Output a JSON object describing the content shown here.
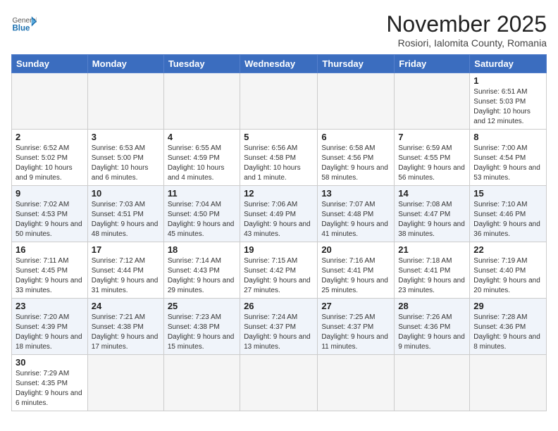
{
  "logo": {
    "general": "General",
    "blue": "Blue"
  },
  "title": "November 2025",
  "location": "Rosiori, Ialomita County, Romania",
  "headers": [
    "Sunday",
    "Monday",
    "Tuesday",
    "Wednesday",
    "Thursday",
    "Friday",
    "Saturday"
  ],
  "weeks": [
    [
      {
        "day": "",
        "info": ""
      },
      {
        "day": "",
        "info": ""
      },
      {
        "day": "",
        "info": ""
      },
      {
        "day": "",
        "info": ""
      },
      {
        "day": "",
        "info": ""
      },
      {
        "day": "",
        "info": ""
      },
      {
        "day": "1",
        "info": "Sunrise: 6:51 AM\nSunset: 5:03 PM\nDaylight: 10 hours and 12 minutes."
      }
    ],
    [
      {
        "day": "2",
        "info": "Sunrise: 6:52 AM\nSunset: 5:02 PM\nDaylight: 10 hours and 9 minutes."
      },
      {
        "day": "3",
        "info": "Sunrise: 6:53 AM\nSunset: 5:00 PM\nDaylight: 10 hours and 6 minutes."
      },
      {
        "day": "4",
        "info": "Sunrise: 6:55 AM\nSunset: 4:59 PM\nDaylight: 10 hours and 4 minutes."
      },
      {
        "day": "5",
        "info": "Sunrise: 6:56 AM\nSunset: 4:58 PM\nDaylight: 10 hours and 1 minute."
      },
      {
        "day": "6",
        "info": "Sunrise: 6:58 AM\nSunset: 4:56 PM\nDaylight: 9 hours and 58 minutes."
      },
      {
        "day": "7",
        "info": "Sunrise: 6:59 AM\nSunset: 4:55 PM\nDaylight: 9 hours and 56 minutes."
      },
      {
        "day": "8",
        "info": "Sunrise: 7:00 AM\nSunset: 4:54 PM\nDaylight: 9 hours and 53 minutes."
      }
    ],
    [
      {
        "day": "9",
        "info": "Sunrise: 7:02 AM\nSunset: 4:53 PM\nDaylight: 9 hours and 50 minutes."
      },
      {
        "day": "10",
        "info": "Sunrise: 7:03 AM\nSunset: 4:51 PM\nDaylight: 9 hours and 48 minutes."
      },
      {
        "day": "11",
        "info": "Sunrise: 7:04 AM\nSunset: 4:50 PM\nDaylight: 9 hours and 45 minutes."
      },
      {
        "day": "12",
        "info": "Sunrise: 7:06 AM\nSunset: 4:49 PM\nDaylight: 9 hours and 43 minutes."
      },
      {
        "day": "13",
        "info": "Sunrise: 7:07 AM\nSunset: 4:48 PM\nDaylight: 9 hours and 41 minutes."
      },
      {
        "day": "14",
        "info": "Sunrise: 7:08 AM\nSunset: 4:47 PM\nDaylight: 9 hours and 38 minutes."
      },
      {
        "day": "15",
        "info": "Sunrise: 7:10 AM\nSunset: 4:46 PM\nDaylight: 9 hours and 36 minutes."
      }
    ],
    [
      {
        "day": "16",
        "info": "Sunrise: 7:11 AM\nSunset: 4:45 PM\nDaylight: 9 hours and 33 minutes."
      },
      {
        "day": "17",
        "info": "Sunrise: 7:12 AM\nSunset: 4:44 PM\nDaylight: 9 hours and 31 minutes."
      },
      {
        "day": "18",
        "info": "Sunrise: 7:14 AM\nSunset: 4:43 PM\nDaylight: 9 hours and 29 minutes."
      },
      {
        "day": "19",
        "info": "Sunrise: 7:15 AM\nSunset: 4:42 PM\nDaylight: 9 hours and 27 minutes."
      },
      {
        "day": "20",
        "info": "Sunrise: 7:16 AM\nSunset: 4:41 PM\nDaylight: 9 hours and 25 minutes."
      },
      {
        "day": "21",
        "info": "Sunrise: 7:18 AM\nSunset: 4:41 PM\nDaylight: 9 hours and 23 minutes."
      },
      {
        "day": "22",
        "info": "Sunrise: 7:19 AM\nSunset: 4:40 PM\nDaylight: 9 hours and 20 minutes."
      }
    ],
    [
      {
        "day": "23",
        "info": "Sunrise: 7:20 AM\nSunset: 4:39 PM\nDaylight: 9 hours and 18 minutes."
      },
      {
        "day": "24",
        "info": "Sunrise: 7:21 AM\nSunset: 4:38 PM\nDaylight: 9 hours and 17 minutes."
      },
      {
        "day": "25",
        "info": "Sunrise: 7:23 AM\nSunset: 4:38 PM\nDaylight: 9 hours and 15 minutes."
      },
      {
        "day": "26",
        "info": "Sunrise: 7:24 AM\nSunset: 4:37 PM\nDaylight: 9 hours and 13 minutes."
      },
      {
        "day": "27",
        "info": "Sunrise: 7:25 AM\nSunset: 4:37 PM\nDaylight: 9 hours and 11 minutes."
      },
      {
        "day": "28",
        "info": "Sunrise: 7:26 AM\nSunset: 4:36 PM\nDaylight: 9 hours and 9 minutes."
      },
      {
        "day": "29",
        "info": "Sunrise: 7:28 AM\nSunset: 4:36 PM\nDaylight: 9 hours and 8 minutes."
      }
    ],
    [
      {
        "day": "30",
        "info": "Sunrise: 7:29 AM\nSunset: 4:35 PM\nDaylight: 9 hours and 6 minutes."
      },
      {
        "day": "",
        "info": ""
      },
      {
        "day": "",
        "info": ""
      },
      {
        "day": "",
        "info": ""
      },
      {
        "day": "",
        "info": ""
      },
      {
        "day": "",
        "info": ""
      },
      {
        "day": "",
        "info": ""
      }
    ]
  ]
}
